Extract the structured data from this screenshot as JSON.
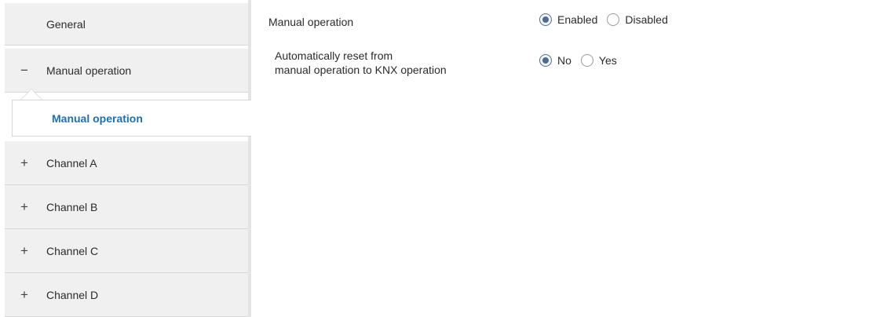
{
  "sidebar": {
    "items": [
      {
        "sign": "",
        "label": "General"
      },
      {
        "sign": "−",
        "label": "Manual operation"
      },
      {
        "sign": "+",
        "label": "Channel A"
      },
      {
        "sign": "+",
        "label": "Channel B"
      },
      {
        "sign": "+",
        "label": "Channel C"
      },
      {
        "sign": "+",
        "label": "Channel D"
      }
    ],
    "subitem": {
      "label": "Manual operation"
    }
  },
  "params": {
    "manual_operation": {
      "label": "Manual operation",
      "options": [
        "Enabled",
        "Disabled"
      ],
      "selected": "Enabled"
    },
    "auto_reset": {
      "label_line1": "Automatically reset from",
      "label_line2": "manual operation to KNX operation",
      "options": [
        "No",
        "Yes"
      ],
      "selected": "No"
    }
  },
  "colors": {
    "active_link": "#1f6fb2",
    "sidebar_bg": "#f0f0f0"
  }
}
